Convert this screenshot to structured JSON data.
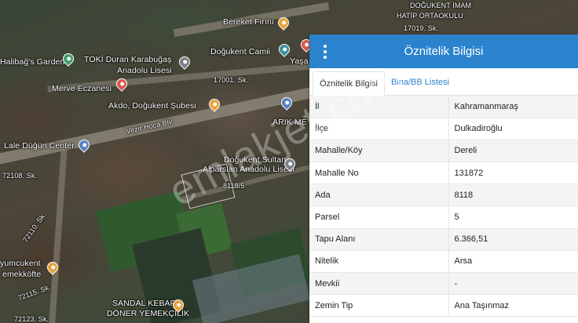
{
  "map": {
    "labels": [
      {
        "id": "bereket",
        "text": "Bereket Fırını"
      },
      {
        "id": "imam-hatip-1",
        "text": "DOĞUKENT İMAM"
      },
      {
        "id": "imam-hatip-2",
        "text": "HATİP ORTAOKULU"
      },
      {
        "id": "street-17019",
        "text": "17019. Sk."
      },
      {
        "id": "cami",
        "text": "Doğukent Camii"
      },
      {
        "id": "yasa",
        "text": "Yaşa"
      },
      {
        "id": "garden",
        "text": "Halibağ's Garden"
      },
      {
        "id": "toki-1",
        "text": "TOKİ Duran Karabuğaş"
      },
      {
        "id": "toki-2",
        "text": "Anadolu Lisesi"
      },
      {
        "id": "street-17001",
        "text": "17001. Sk."
      },
      {
        "id": "eczane",
        "text": "Merve Eczanesi"
      },
      {
        "id": "akdo",
        "text": "Akdo, Doğukent Şubesi"
      },
      {
        "id": "arik",
        "text": "ARIK ME"
      },
      {
        "id": "vezir",
        "text": "Vezir Hoca Blv."
      },
      {
        "id": "lale",
        "text": "Lale Düğün Center"
      },
      {
        "id": "dsa-1",
        "text": "Doğukent Sultan"
      },
      {
        "id": "dsa-2",
        "text": "Alparslan Anadolu Lisesi"
      },
      {
        "id": "parcel",
        "text": "8118/5"
      },
      {
        "id": "street-72108",
        "text": "72108. Sk."
      },
      {
        "id": "street-72110",
        "text": "72110. Sk."
      },
      {
        "id": "yumcukent-1",
        "text": "yumcukent"
      },
      {
        "id": "yumcukent-2",
        "text": "emekköfte"
      },
      {
        "id": "street-72115",
        "text": "72115. Sk."
      },
      {
        "id": "sandal-1",
        "text": "SANDAL KEBAP"
      },
      {
        "id": "sandal-2",
        "text": "DÖNER YEMEKÇİLİK"
      },
      {
        "id": "street-72123",
        "text": "72123. Sk."
      }
    ],
    "watermark": "emlakjet.com"
  },
  "panel": {
    "title": "Öznitelik Bilgisi",
    "tabs": [
      {
        "label": "Öznitelik Bilgisi",
        "active": true
      },
      {
        "label": "Bina/BB Listesi",
        "active": false
      }
    ],
    "rows": [
      {
        "key": "İl",
        "value": "Kahramanmaraş"
      },
      {
        "key": "İlçe",
        "value": "Dulkadiroğlu"
      },
      {
        "key": "Mahalle/Köy",
        "value": "Dereli"
      },
      {
        "key": "Mahalle No",
        "value": "131872"
      },
      {
        "key": "Ada",
        "value": "8118"
      },
      {
        "key": "Parsel",
        "value": "5"
      },
      {
        "key": "Tapu Alanı",
        "value": "6.366,51"
      },
      {
        "key": "Nitelik",
        "value": "Arsa"
      },
      {
        "key": "Mevkii",
        "value": "-"
      },
      {
        "key": "Zemin Tip",
        "value": "Ana Taşınmaz"
      }
    ],
    "colors": {
      "header": "#2c83cd",
      "tab_link": "#2c83cd"
    }
  }
}
